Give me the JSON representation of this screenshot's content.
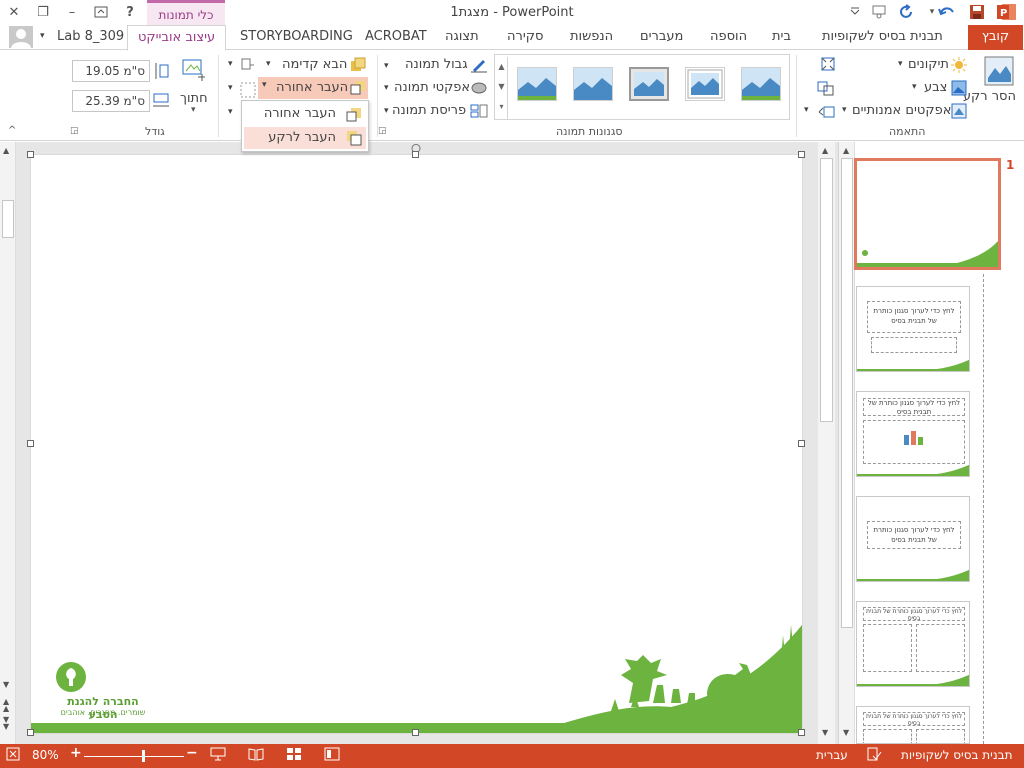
{
  "window": {
    "title": "מצגת1 - PowerPoint",
    "help": "?",
    "minimize": "–",
    "maximize": "❐",
    "close": "✕"
  },
  "tabs": {
    "file": "קובץ",
    "slide_master": "תבנית בסיס לשקופיות",
    "home": "בית",
    "insert": "הוספה",
    "transitions": "מעברים",
    "animations": "הנפשות",
    "review": "סקירה",
    "view": "תצוגה",
    "acrobat": "ACROBAT",
    "storyboarding": "STORYBOARDING",
    "format": "עיצוב אובייקט",
    "user": "Lab 8_309",
    "context_group": "כלי תמונות"
  },
  "ribbon": {
    "remove_bg": "הסר רקע",
    "corrections": "תיקונים",
    "color": "צבע",
    "artistic_effects": "אפקטים אמנותיים",
    "adjust_group": "התאמה",
    "styles_group": "סגנונות תמונה",
    "picture_border": "גבול תמונה",
    "picture_effects": "אפקטי תמונה",
    "picture_layout": "פריסת תמונה",
    "bring_forward": "הבא קדימה",
    "send_backward": "העבר אחורה",
    "crop": "חתוך",
    "height": "19.05 ס\"מ",
    "width": "25.39 ס\"מ",
    "size_group": "גודל"
  },
  "dropdown": {
    "send_backward": "העבר אחורה",
    "send_to_back": "העבר לרקע"
  },
  "slides": {
    "selected_number": "1",
    "placeholder_text": "לחץ כדי לערוך סגנון כותרת של תבנית בסיס"
  },
  "slide": {
    "logo_line1": "החברה להגנת הטבע",
    "logo_line2": "שומרים. מחנכים. אוהבים"
  },
  "statusbar": {
    "view_name": "תבנית בסיס לשקופיות",
    "language": "עברית",
    "zoom": "80%"
  },
  "colors": {
    "accent": "#d24726",
    "context": "#9b3b86",
    "green": "#6db33f"
  }
}
